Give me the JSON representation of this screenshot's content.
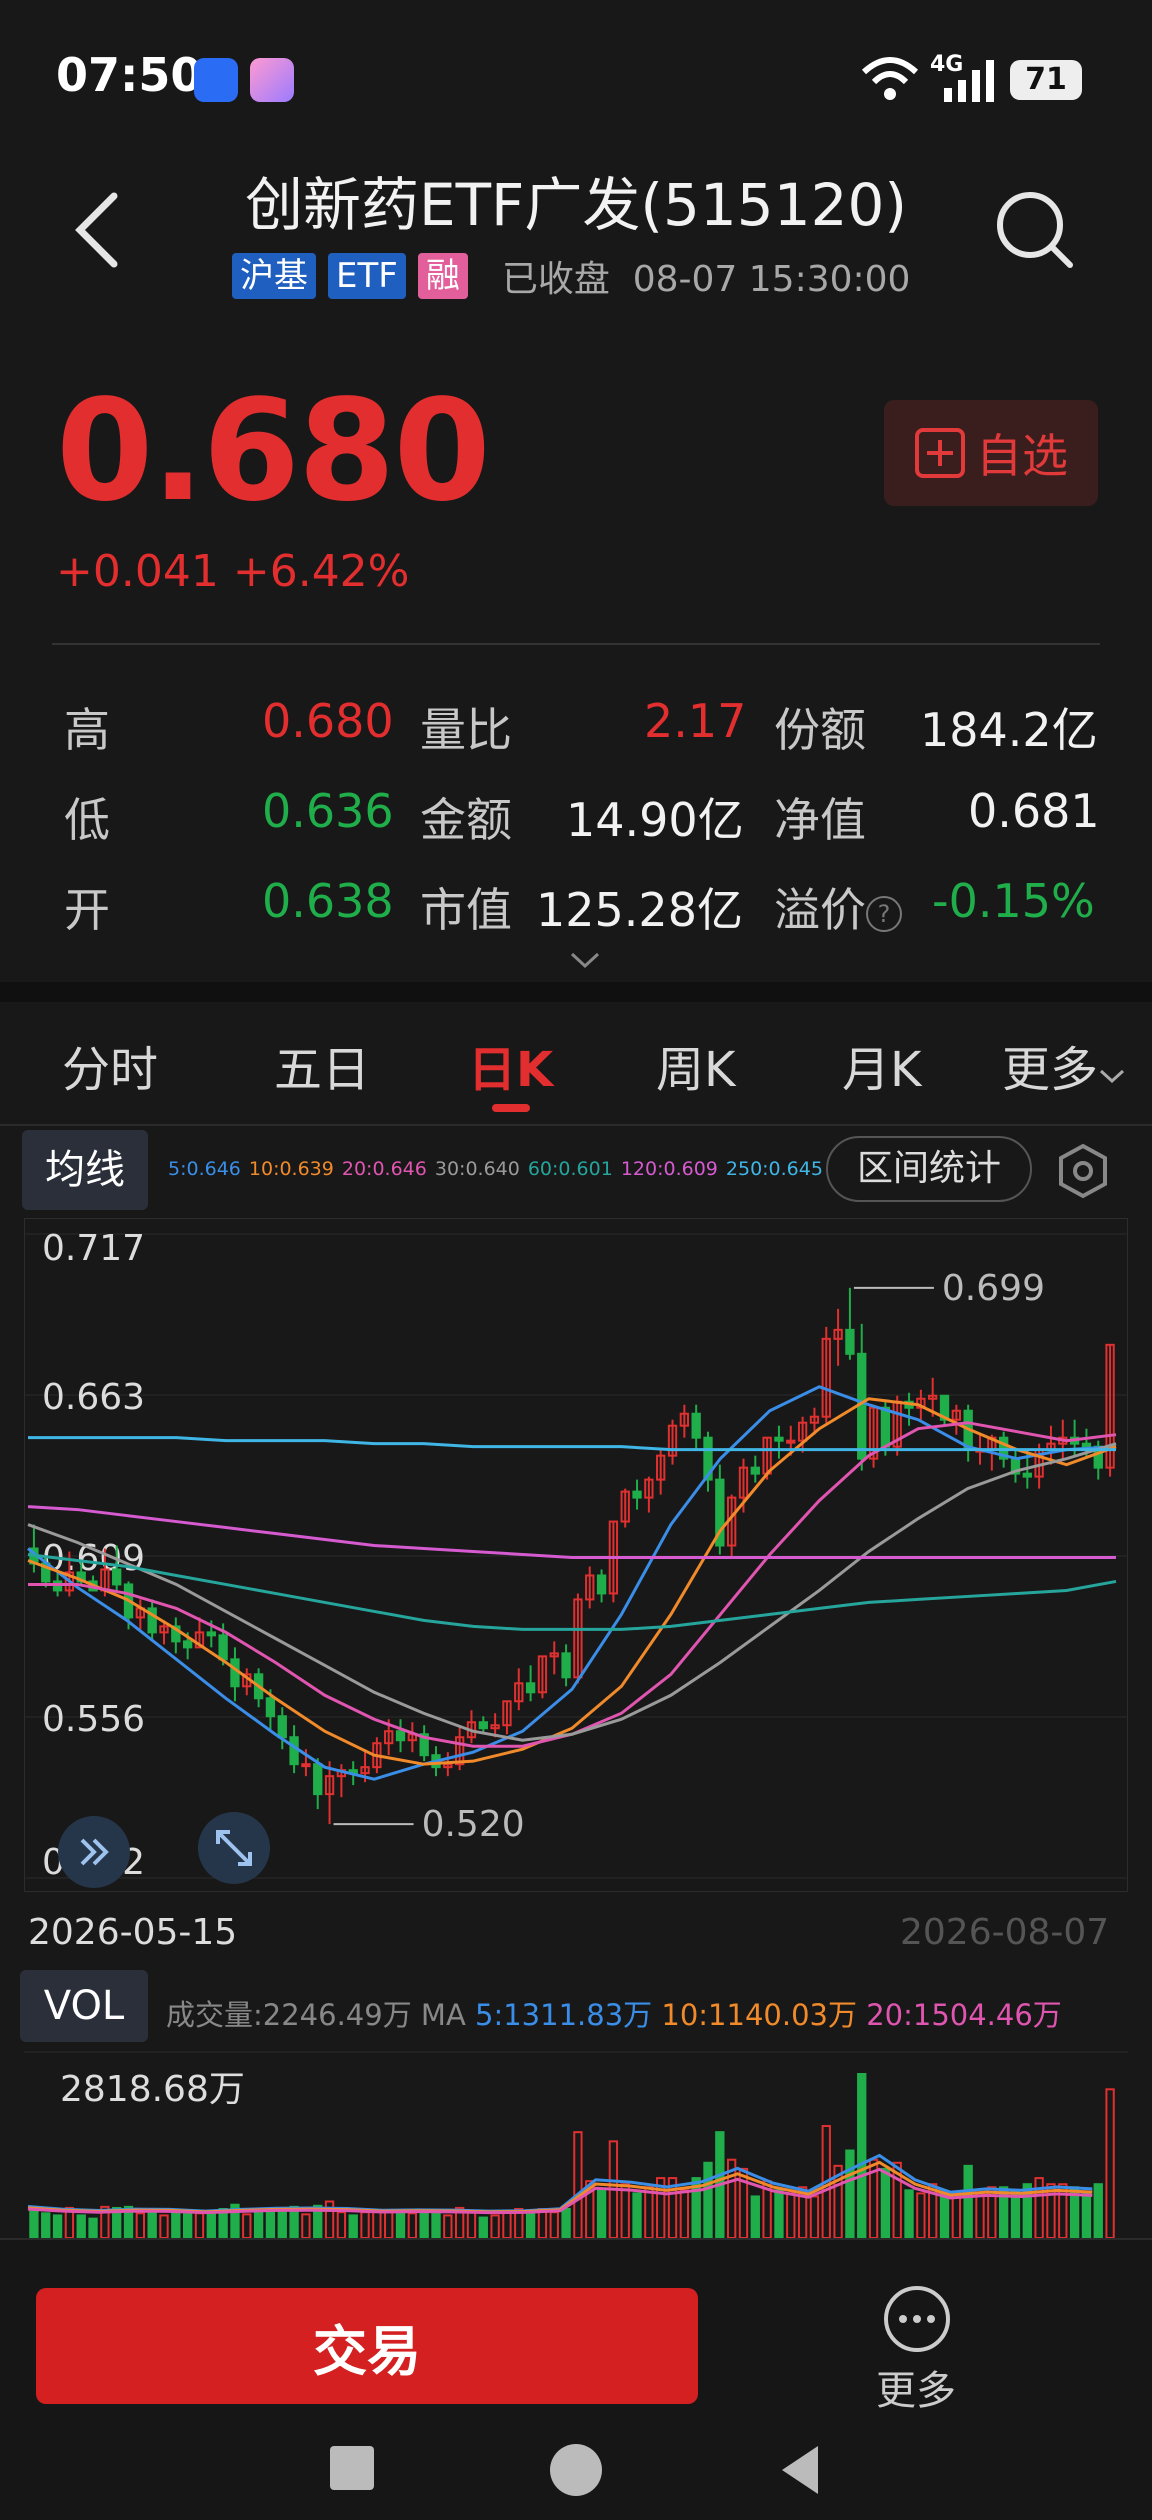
{
  "status_bar": {
    "time": "07:50",
    "network": "4G",
    "battery": "71"
  },
  "header": {
    "title": "创新药ETF广发(515120)",
    "tags": [
      "沪基",
      "ETF",
      "融"
    ],
    "trade_status": "已收盘",
    "datetime": "08-07  15:30:00"
  },
  "quote": {
    "price": "0.680",
    "change": "+0.041",
    "change_pct": "+6.42%",
    "watch_label": "自选"
  },
  "stats": {
    "high_label": "高",
    "high": "0.680",
    "low_label": "低",
    "low": "0.636",
    "open_label": "开",
    "open": "0.638",
    "volume_ratio_label": "量比",
    "volume_ratio": "2.17",
    "turnover_label": "金额",
    "turnover": "14.90亿",
    "market_cap_label": "市值",
    "market_cap": "125.28亿",
    "shares_label": "份额",
    "shares": "184.2亿",
    "nav_label": "净值",
    "nav": "0.681",
    "premium_label": "溢价",
    "premium": "-0.15%"
  },
  "tabs": [
    "分时",
    "五日",
    "日K",
    "周K",
    "月K",
    "更多"
  ],
  "active_tab": "日K",
  "ma_panel": {
    "badge": "均线",
    "range_button": "区间统计",
    "legend": [
      {
        "text": "5:0.646",
        "color": "#3a8ee8"
      },
      {
        "text": "10:0.639",
        "color": "#f08a2a"
      },
      {
        "text": "20:0.646",
        "color": "#e055b0"
      },
      {
        "text": "30:0.640",
        "color": "#9a9a9a"
      },
      {
        "text": "60:0.601",
        "color": "#25a59c"
      },
      {
        "text": "120:0.609",
        "color": "#d65ad0"
      },
      {
        "text": "250:0.645",
        "color": "#3fb6e6"
      }
    ]
  },
  "chart_data": {
    "type": "line",
    "y_ticks": [
      "0.717",
      "0.663",
      "0.609",
      "0.556",
      "0.502"
    ],
    "ylim": [
      0.502,
      0.717
    ],
    "max_annotation": "0.699",
    "min_annotation": "0.520",
    "start_date": "2026-05-15",
    "end_date": "2026-08-07",
    "candles": {
      "open": [
        0.612,
        0.607,
        0.601,
        0.598,
        0.604,
        0.601,
        0.598,
        0.605,
        0.6,
        0.589,
        0.592,
        0.584,
        0.586,
        0.581,
        0.579,
        0.584,
        0.583,
        0.575,
        0.566,
        0.57,
        0.562,
        0.556,
        0.549,
        0.54,
        0.54,
        0.53,
        0.536,
        0.538,
        0.537,
        0.539,
        0.547,
        0.551,
        0.548,
        0.55,
        0.543,
        0.539,
        0.54,
        0.549,
        0.554,
        0.552,
        0.553,
        0.561,
        0.567,
        0.564,
        0.576,
        0.577,
        0.569,
        0.595,
        0.603,
        0.597,
        0.621,
        0.631,
        0.629,
        0.635,
        0.643,
        0.653,
        0.657,
        0.649,
        0.635,
        0.613,
        0.629,
        0.639,
        0.637,
        0.649,
        0.648,
        0.648,
        0.654,
        0.656,
        0.682,
        0.685,
        0.677,
        0.642,
        0.659,
        0.646,
        0.661,
        0.659,
        0.662,
        0.663,
        0.655,
        0.658,
        0.645,
        0.645,
        0.649,
        0.642,
        0.637,
        0.636,
        0.645,
        0.647,
        0.649,
        0.647,
        0.646,
        0.639
      ],
      "high": [
        0.62,
        0.609,
        0.604,
        0.611,
        0.608,
        0.603,
        0.612,
        0.613,
        0.601,
        0.595,
        0.595,
        0.588,
        0.589,
        0.584,
        0.589,
        0.588,
        0.587,
        0.579,
        0.572,
        0.572,
        0.565,
        0.559,
        0.553,
        0.545,
        0.542,
        0.541,
        0.54,
        0.541,
        0.545,
        0.549,
        0.555,
        0.555,
        0.554,
        0.553,
        0.546,
        0.544,
        0.553,
        0.558,
        0.556,
        0.557,
        0.561,
        0.572,
        0.573,
        0.576,
        0.581,
        0.58,
        0.597,
        0.606,
        0.605,
        0.621,
        0.632,
        0.635,
        0.636,
        0.645,
        0.655,
        0.66,
        0.66,
        0.651,
        0.64,
        0.63,
        0.642,
        0.643,
        0.649,
        0.653,
        0.653,
        0.656,
        0.659,
        0.686,
        0.692,
        0.699,
        0.687,
        0.66,
        0.661,
        0.663,
        0.664,
        0.665,
        0.669,
        0.663,
        0.66,
        0.66,
        0.65,
        0.65,
        0.651,
        0.645,
        0.645,
        0.647,
        0.653,
        0.655,
        0.655,
        0.652,
        0.648,
        0.68
      ],
      "low": [
        0.604,
        0.599,
        0.596,
        0.596,
        0.6,
        0.598,
        0.596,
        0.598,
        0.585,
        0.585,
        0.581,
        0.58,
        0.577,
        0.575,
        0.579,
        0.579,
        0.573,
        0.561,
        0.563,
        0.559,
        0.551,
        0.545,
        0.537,
        0.536,
        0.525,
        0.52,
        0.529,
        0.533,
        0.534,
        0.537,
        0.543,
        0.544,
        0.544,
        0.541,
        0.536,
        0.536,
        0.538,
        0.547,
        0.55,
        0.549,
        0.55,
        0.558,
        0.561,
        0.562,
        0.57,
        0.566,
        0.567,
        0.592,
        0.594,
        0.594,
        0.619,
        0.625,
        0.624,
        0.63,
        0.64,
        0.649,
        0.645,
        0.631,
        0.61,
        0.609,
        0.624,
        0.634,
        0.635,
        0.642,
        0.643,
        0.644,
        0.65,
        0.654,
        0.673,
        0.675,
        0.638,
        0.639,
        0.643,
        0.643,
        0.653,
        0.655,
        0.656,
        0.653,
        0.65,
        0.641,
        0.64,
        0.638,
        0.639,
        0.634,
        0.632,
        0.632,
        0.64,
        0.642,
        0.643,
        0.642,
        0.635,
        0.636
      ],
      "close": [
        0.607,
        0.601,
        0.598,
        0.604,
        0.601,
        0.598,
        0.605,
        0.6,
        0.589,
        0.592,
        0.584,
        0.586,
        0.581,
        0.579,
        0.584,
        0.583,
        0.575,
        0.566,
        0.57,
        0.562,
        0.556,
        0.549,
        0.54,
        0.54,
        0.53,
        0.536,
        0.538,
        0.537,
        0.539,
        0.547,
        0.551,
        0.548,
        0.55,
        0.543,
        0.539,
        0.54,
        0.549,
        0.554,
        0.552,
        0.553,
        0.561,
        0.567,
        0.564,
        0.576,
        0.577,
        0.569,
        0.595,
        0.603,
        0.597,
        0.621,
        0.631,
        0.629,
        0.635,
        0.643,
        0.653,
        0.657,
        0.649,
        0.635,
        0.613,
        0.629,
        0.639,
        0.637,
        0.649,
        0.648,
        0.648,
        0.654,
        0.656,
        0.682,
        0.685,
        0.677,
        0.642,
        0.659,
        0.646,
        0.661,
        0.659,
        0.662,
        0.663,
        0.655,
        0.658,
        0.645,
        0.645,
        0.649,
        0.642,
        0.637,
        0.636,
        0.645,
        0.647,
        0.649,
        0.647,
        0.646,
        0.639,
        0.68
      ]
    },
    "ma_lines": [
      {
        "name": "5",
        "color": "#3a8ee8",
        "points": [
          0.612,
          0.599,
          0.588,
          0.575,
          0.562,
          0.55,
          0.539,
          0.535,
          0.54,
          0.544,
          0.551,
          0.565,
          0.59,
          0.62,
          0.642,
          0.658,
          0.666,
          0.66,
          0.655,
          0.646,
          0.642,
          0.645,
          0.646
        ]
      },
      {
        "name": "10",
        "color": "#f08a2a",
        "points": [
          0.608,
          0.602,
          0.595,
          0.585,
          0.574,
          0.562,
          0.551,
          0.543,
          0.54,
          0.541,
          0.545,
          0.552,
          0.566,
          0.59,
          0.618,
          0.638,
          0.652,
          0.662,
          0.66,
          0.652,
          0.645,
          0.64,
          0.646
        ]
      },
      {
        "name": "20",
        "color": "#e055b0",
        "points": [
          0.6,
          0.6,
          0.597,
          0.592,
          0.584,
          0.574,
          0.563,
          0.555,
          0.549,
          0.546,
          0.546,
          0.55,
          0.557,
          0.57,
          0.59,
          0.61,
          0.628,
          0.643,
          0.652,
          0.654,
          0.651,
          0.648,
          0.65
        ]
      },
      {
        "name": "30",
        "color": "#9a9a9a",
        "points": [
          0.62,
          0.614,
          0.607,
          0.6,
          0.591,
          0.582,
          0.573,
          0.564,
          0.557,
          0.551,
          0.548,
          0.55,
          0.555,
          0.563,
          0.574,
          0.586,
          0.598,
          0.611,
          0.622,
          0.632,
          0.638,
          0.642,
          0.647
        ]
      },
      {
        "name": "60",
        "color": "#25a59c",
        "points": [
          0.61,
          0.608,
          0.606,
          0.603,
          0.6,
          0.597,
          0.594,
          0.591,
          0.588,
          0.586,
          0.585,
          0.585,
          0.585,
          0.586,
          0.588,
          0.59,
          0.592,
          0.594,
          0.595,
          0.596,
          0.597,
          0.598,
          0.601
        ]
      },
      {
        "name": "120",
        "color": "#d65ad0",
        "points": [
          0.626,
          0.625,
          0.623,
          0.621,
          0.619,
          0.617,
          0.615,
          0.613,
          0.612,
          0.611,
          0.61,
          0.609,
          0.609,
          0.609,
          0.609,
          0.609,
          0.609,
          0.609,
          0.609,
          0.609,
          0.609,
          0.609,
          0.609
        ]
      },
      {
        "name": "250",
        "color": "#3fb6e6",
        "points": [
          0.649,
          0.649,
          0.649,
          0.649,
          0.648,
          0.648,
          0.648,
          0.647,
          0.647,
          0.646,
          0.646,
          0.646,
          0.646,
          0.645,
          0.645,
          0.645,
          0.645,
          0.645,
          0.645,
          0.645,
          0.645,
          0.645,
          0.645
        ]
      }
    ]
  },
  "volume_panel": {
    "badge": "VOL",
    "volume_label": "成交量:2246.49万",
    "ma_label": "MA",
    "ma5": "5:1311.83万",
    "ma10": "10:1140.03万",
    "ma20": "20:1504.46万",
    "ma5_color": "#3a8ee8",
    "ma10_color": "#f08a2a",
    "ma20_color": "#e055b0",
    "max_label": "2818.68万",
    "max_value": 2818.68
  },
  "bottom": {
    "trade_label": "交易",
    "more_label": "更多"
  }
}
